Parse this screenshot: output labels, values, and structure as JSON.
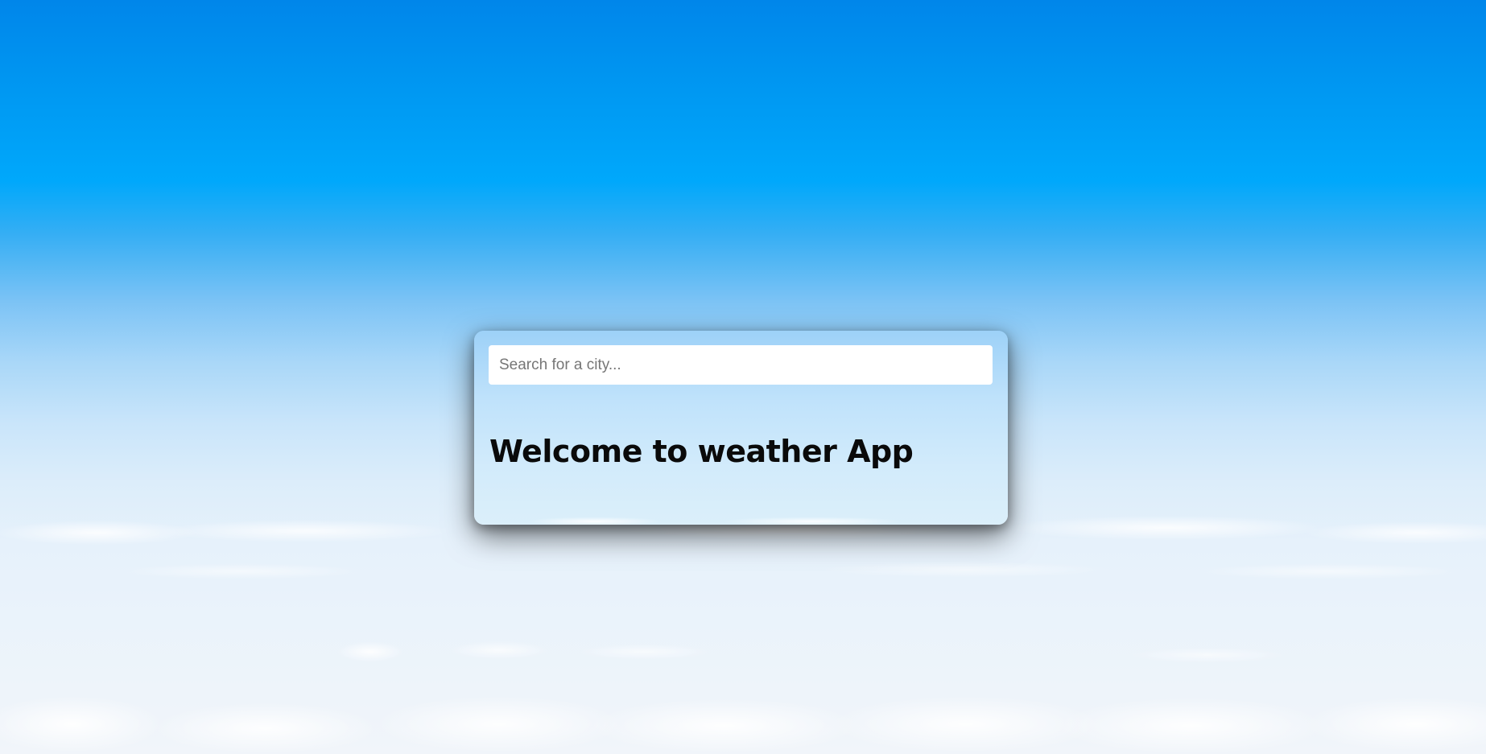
{
  "search": {
    "placeholder": "Search for a city...",
    "value": ""
  },
  "welcome": {
    "title": "Welcome to weather App"
  }
}
